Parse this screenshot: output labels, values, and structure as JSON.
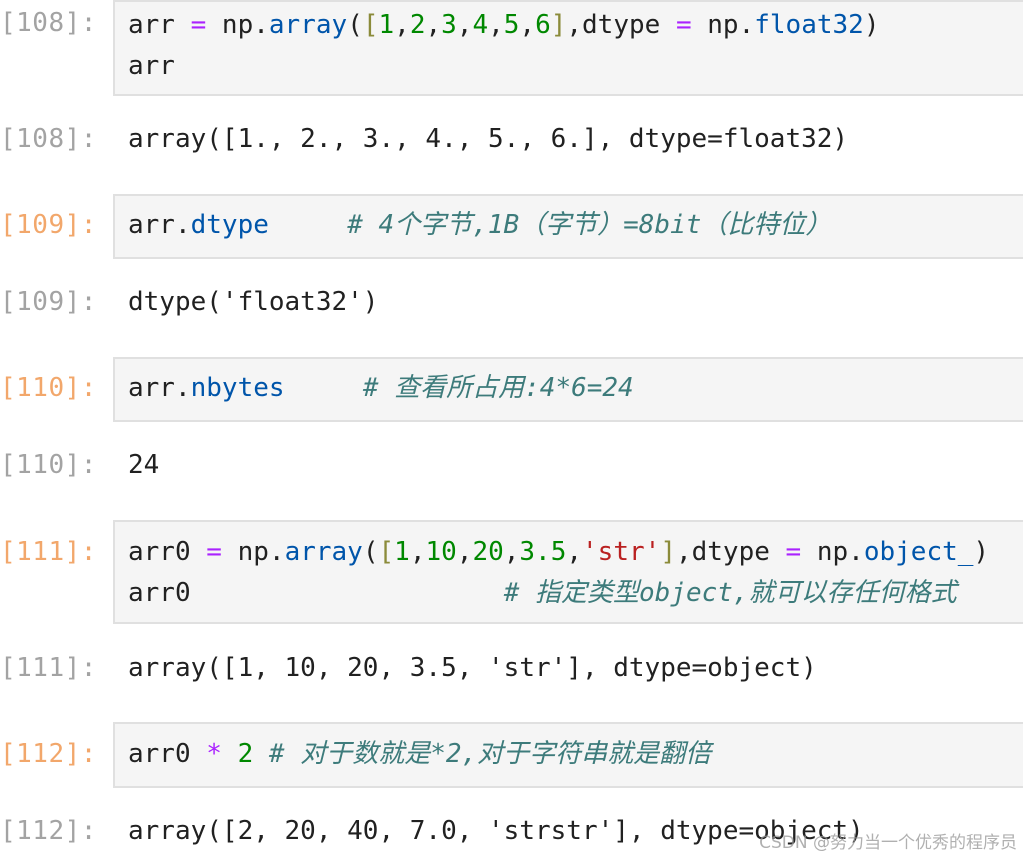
{
  "cells": [
    {
      "input_prompt": "[108]:",
      "input_state": "done",
      "code_lines": [
        [
          [
            "t-plain",
            "arr "
          ],
          [
            "t-op",
            "="
          ],
          [
            "t-plain",
            " np."
          ],
          [
            "t-kw",
            "array"
          ],
          [
            "t-plain",
            "("
          ],
          [
            "t-brk",
            "["
          ],
          [
            "t-num",
            "1"
          ],
          [
            "t-plain",
            ","
          ],
          [
            "t-num",
            "2"
          ],
          [
            "t-plain",
            ","
          ],
          [
            "t-num",
            "3"
          ],
          [
            "t-plain",
            ","
          ],
          [
            "t-num",
            "4"
          ],
          [
            "t-plain",
            ","
          ],
          [
            "t-num",
            "5"
          ],
          [
            "t-plain",
            ","
          ],
          [
            "t-num",
            "6"
          ],
          [
            "t-brk",
            "]"
          ],
          [
            "t-plain",
            ",dtype "
          ],
          [
            "t-op",
            "="
          ],
          [
            "t-plain",
            " np."
          ],
          [
            "t-kw",
            "float32"
          ],
          [
            "t-plain",
            ")"
          ]
        ],
        [
          [
            "t-plain",
            "arr"
          ]
        ]
      ],
      "output_prompt": "[108]:",
      "output_text": "array([1., 2., 3., 4., 5., 6.], dtype=float32)"
    },
    {
      "input_prompt": "[109]:",
      "input_state": "running",
      "code_lines": [
        [
          [
            "t-plain",
            "arr."
          ],
          [
            "t-kw",
            "dtype"
          ],
          [
            "t-plain",
            "     "
          ],
          [
            "t-cm",
            "# 4个字节,1B（字节）=8bit（比特位）"
          ]
        ]
      ],
      "output_prompt": "[109]:",
      "output_text": "dtype('float32')"
    },
    {
      "input_prompt": "[110]:",
      "input_state": "running",
      "code_lines": [
        [
          [
            "t-plain",
            "arr."
          ],
          [
            "t-kw",
            "nbytes"
          ],
          [
            "t-plain",
            "     "
          ],
          [
            "t-cm",
            "# 查看所占用:4*6=24"
          ]
        ]
      ],
      "output_prompt": "[110]:",
      "output_text": "24"
    },
    {
      "input_prompt": "[111]:",
      "input_state": "running",
      "code_lines": [
        [
          [
            "t-plain",
            "arr0 "
          ],
          [
            "t-op",
            "="
          ],
          [
            "t-plain",
            " np."
          ],
          [
            "t-kw",
            "array"
          ],
          [
            "t-plain",
            "("
          ],
          [
            "t-brk",
            "["
          ],
          [
            "t-num",
            "1"
          ],
          [
            "t-plain",
            ","
          ],
          [
            "t-num",
            "10"
          ],
          [
            "t-plain",
            ","
          ],
          [
            "t-num",
            "20"
          ],
          [
            "t-plain",
            ","
          ],
          [
            "t-num",
            "3.5"
          ],
          [
            "t-plain",
            ","
          ],
          [
            "t-str",
            "'str'"
          ],
          [
            "t-brk",
            "]"
          ],
          [
            "t-plain",
            ",dtype "
          ],
          [
            "t-op",
            "="
          ],
          [
            "t-plain",
            " np."
          ],
          [
            "t-kw",
            "object_"
          ],
          [
            "t-plain",
            ")"
          ]
        ],
        [
          [
            "t-plain",
            "arr0                    "
          ],
          [
            "t-cm",
            "# 指定类型object,就可以存任何格式"
          ]
        ]
      ],
      "output_prompt": "[111]:",
      "output_text": "array([1, 10, 20, 3.5, 'str'], dtype=object)"
    },
    {
      "input_prompt": "[112]:",
      "input_state": "running",
      "code_lines": [
        [
          [
            "t-plain",
            "arr0 "
          ],
          [
            "t-op",
            "*"
          ],
          [
            "t-plain",
            " "
          ],
          [
            "t-num",
            "2"
          ],
          [
            "t-plain",
            " "
          ],
          [
            "t-cm",
            "# 对于数就是*2,对于字符串就是翻倍"
          ]
        ]
      ],
      "output_prompt": "[112]:",
      "output_text": "array([2, 20, 40, 7.0, 'strstr'], dtype=object)"
    }
  ],
  "watermark": "CSDN @努力当一个优秀的程序员",
  "colors": {
    "prompt_running": "#f2a76b",
    "prompt_done": "#a3a3a3",
    "editor_bg": "#f5f5f5",
    "editor_border": "#e0e0e0",
    "keyword": "#0055aa",
    "operator": "#aa22ff",
    "number": "#008800",
    "string": "#ba2121",
    "comment": "#3d7b7b"
  }
}
